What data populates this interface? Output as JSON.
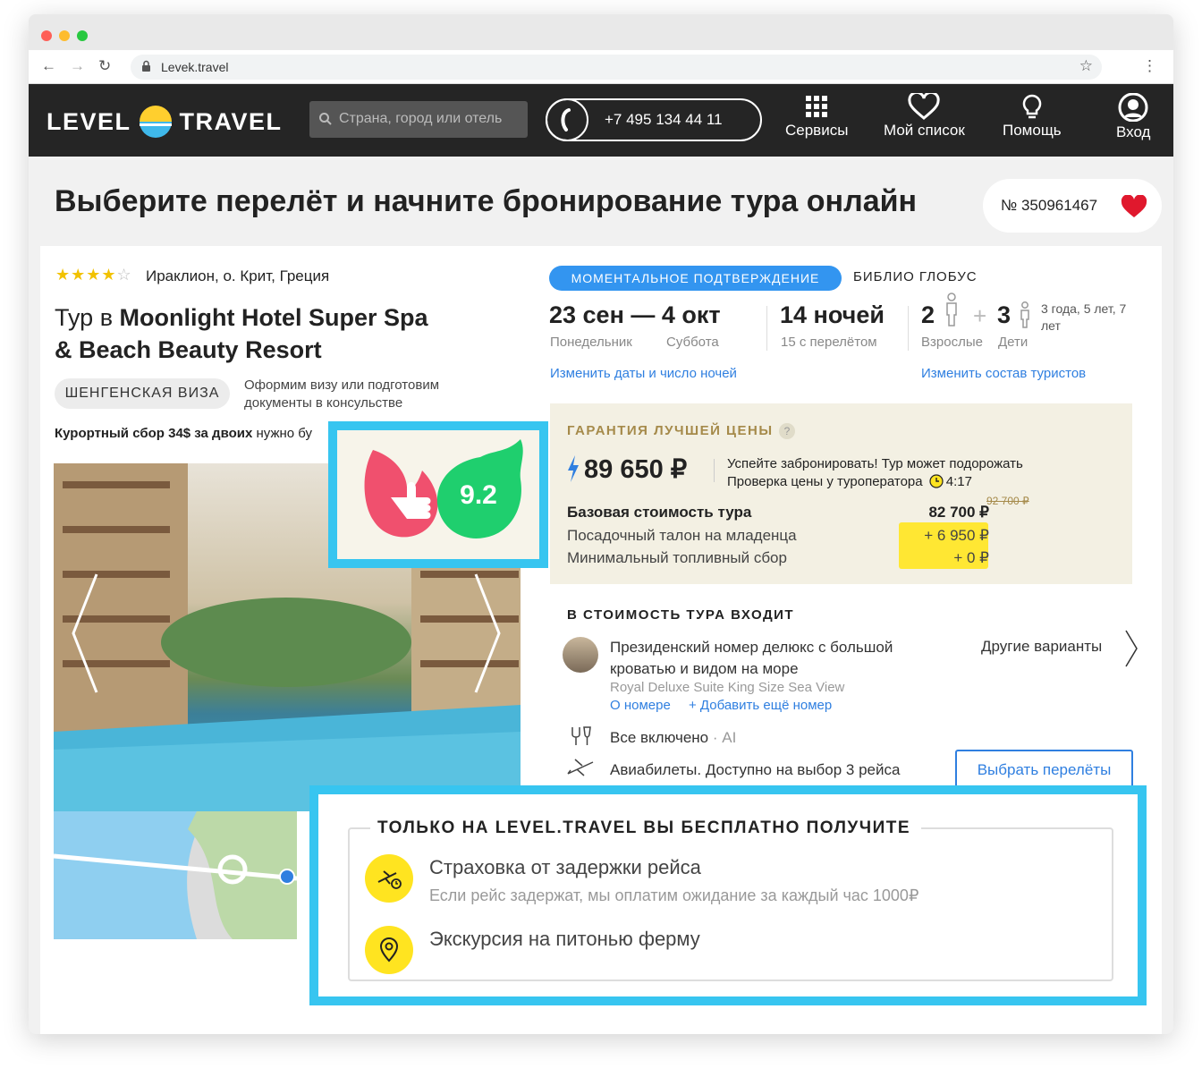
{
  "browser": {
    "url": "Levek.travel"
  },
  "header": {
    "logo_left": "LEVEL",
    "logo_right": "TRAVEL",
    "search_placeholder": "Страна, город или отель",
    "phone": "+7 495 134 44 11",
    "nav": [
      {
        "label": "Сервисы",
        "icon": "grid-icon"
      },
      {
        "label": "Мой список",
        "icon": "heart-icon"
      },
      {
        "label": "Помощь",
        "icon": "bulb-icon"
      },
      {
        "label": "Вход",
        "icon": "user-icon"
      }
    ]
  },
  "page": {
    "title": "Выберите перелёт и начните бронирование тура онлайн",
    "order_number": "№ 350961467"
  },
  "hotel": {
    "stars": 4,
    "location": "Ираклион, о. Крит, Греция",
    "title_prefix": "Тур в ",
    "title_bold": "Moonlight Hotel Super Spa & Beach Beauty Resort",
    "visa_badge": "ШЕНГЕНСКАЯ ВИЗА",
    "visa_note": "Оформим визу или подготовим документы в консульстве",
    "fee_bold": "Курортный сбор 34$ за двоих",
    "fee_rest": " нужно бу",
    "rating": "9.2"
  },
  "booking": {
    "confirm_badge": "МОМЕНТАЛЬНОЕ ПОДТВЕРЖДЕНИЕ",
    "operator": "БИБЛИО ГЛОБУС",
    "dates": "23 сен — 4 окт",
    "day_from": "Понедельник",
    "day_to": "Суббота",
    "nights": "14 ночей",
    "nights_sub": "15 с перелётом",
    "adults": "2",
    "adults_label": "Взрослые",
    "kids": "3",
    "kids_label": "Дети",
    "kids_ages": "3 года, 5 лет, 7 лет",
    "change_dates": "Изменить даты и число ночей",
    "change_tourists": "Изменить состав туристов"
  },
  "price": {
    "caption": "ГАРАНТИЯ ЛУЧШЕЙ ЦЕНЫ",
    "help": "?",
    "total": "89 650 ₽",
    "hurry_1": "Успейте забронировать! Тур может подорожать",
    "hurry_2": "Проверка цены у туроператора",
    "timer": "4:17",
    "base_label": "Базовая стоимость тура",
    "base_value": "82 700 ₽",
    "base_old": "92 700 ₽",
    "infant_label": "Посадочный талон на младенца",
    "infant_value": "+ 6 950 ₽",
    "fuel_label": "Минимальный топливный сбор",
    "fuel_value": "+ 0 ₽"
  },
  "included": {
    "caption": "В СТОИМОСТЬ ТУРА ВХОДИТ",
    "room_name": "Президенский номер делюкс с большой кроватью и видом на море",
    "room_name_en": "Royal Deluxe Suite King Size Sea View",
    "about_room": "О номере",
    "add_room": "+ Добавить ещё номер",
    "other_options": "Другие варианты",
    "meal": "Все включено",
    "meal_code": " · AI",
    "flights": "Авиабилеты. Доступно на выбор 3 рейса",
    "choose_flights": "Выбрать перелёты"
  },
  "promo": {
    "caption": "ТОЛЬКО НА LEVEL.TRAVEL ВЫ БЕСПЛАТНО ПОЛУЧИТЕ",
    "insurance_title": "Страховка от задержки рейса",
    "insurance_note": "Если рейс задержат, мы оплатим ожидание за каждый час 1000₽",
    "excursion": "Экскурсия на питонью ферму"
  },
  "colors": {
    "accent": "#37c5f0",
    "link": "#2f7fe0",
    "header": "#252525",
    "highlight": "#ffe733"
  }
}
